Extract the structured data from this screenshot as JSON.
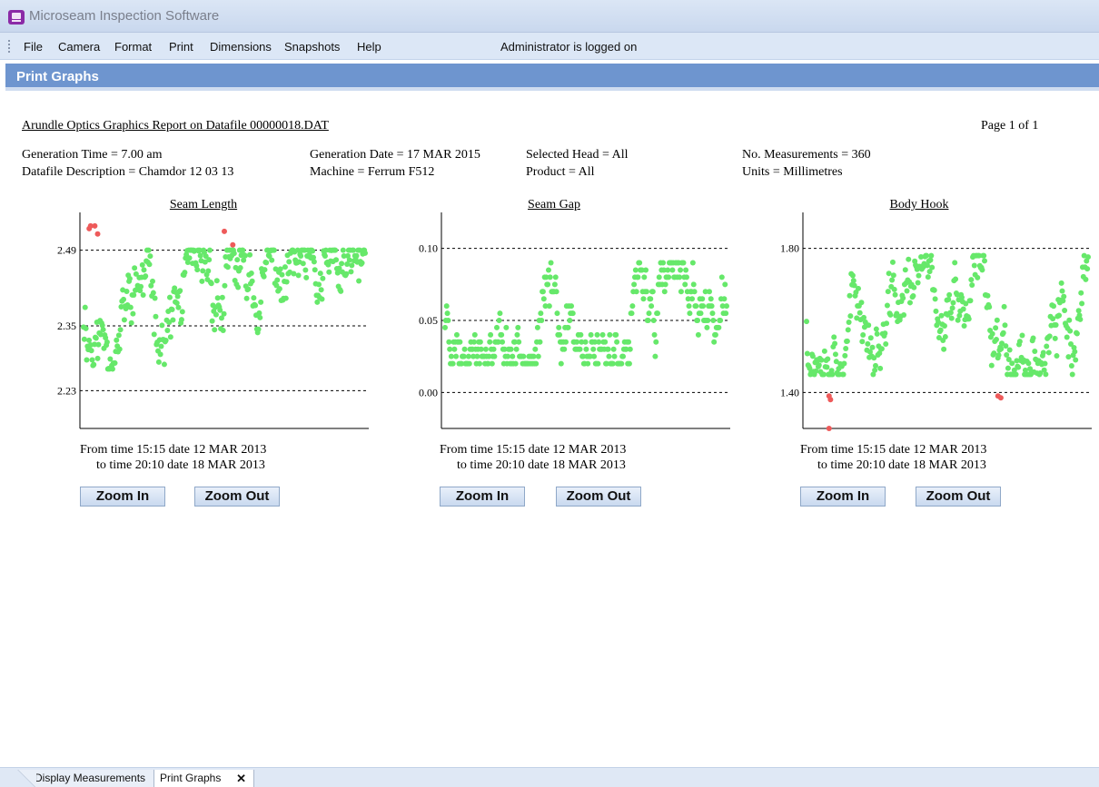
{
  "window": {
    "title": "Microseam Inspection Software"
  },
  "menu": {
    "items": [
      {
        "label": "File"
      },
      {
        "label": "Camera"
      },
      {
        "label": "Format"
      },
      {
        "label": "Print"
      },
      {
        "label": "Dimensions"
      },
      {
        "label": "Snapshots"
      },
      {
        "label": "Help"
      }
    ],
    "status": "Administrator is logged on"
  },
  "header": {
    "title": "Print Graphs"
  },
  "report": {
    "title": "Arundle Optics Graphics Report on Datafile 00000018.DAT",
    "page": "Page 1 of 1",
    "generation_time": "Generation Time = 7.00 am",
    "datafile_description": "Datafile Description = Chamdor 12 03 13",
    "generation_date": "Generation Date = 17 MAR 2015",
    "machine": "Machine = Ferrum F512",
    "selected_head": "Selected Head = All",
    "product": "Product = All",
    "no_measurements": "No. Measurements = 360",
    "units": "Units = Millimetres"
  },
  "buttons": {
    "zoom_in": "Zoom In",
    "zoom_out": "Zoom Out"
  },
  "colors": {
    "in_spec": "#66e86a",
    "out_of_spec": "#ee5a5a",
    "header": "#6e95cf"
  },
  "chart_data": [
    {
      "type": "scatter",
      "title": "Seam Length",
      "ticks": [
        "2.49",
        "2.35",
        "2.23"
      ],
      "limits": [
        2.23,
        2.49
      ],
      "nominal": 2.35,
      "ylim": [
        2.16,
        2.56
      ],
      "points": 360,
      "seed": 11,
      "band": [
        2.27,
        2.49
      ],
      "outliers": [
        [
          0.02,
          2.53
        ],
        [
          0.025,
          2.535
        ],
        [
          0.04,
          2.535
        ],
        [
          0.05,
          2.52
        ],
        [
          0.5,
          2.525
        ],
        [
          0.53,
          2.5
        ]
      ],
      "time_from": "From time 15:15 date 12 MAR 2013",
      "time_to": "to time 20:10 date 18 MAR 2013"
    },
    {
      "type": "scatter",
      "title": "Seam Gap",
      "ticks": [
        "0.10",
        "0.05",
        "0.00"
      ],
      "limits": [
        0.0,
        0.1
      ],
      "nominal": 0.05,
      "ylim": [
        -0.025,
        0.125
      ],
      "points": 360,
      "seed": 23,
      "band": [
        0.02,
        0.09
      ],
      "outliers": [],
      "time_from": "From time 15:15 date 12 MAR 2013",
      "time_to": "to time 20:10 date 18 MAR 2013"
    },
    {
      "type": "scatter",
      "title": "Body Hook",
      "ticks": [
        "1.80",
        "1.40"
      ],
      "limits": [
        1.4,
        1.8
      ],
      "nominal": 1.6,
      "ylim": [
        1.3,
        1.9
      ],
      "points": 360,
      "seed": 37,
      "band": [
        1.45,
        1.78
      ],
      "outliers": [
        [
          0.08,
          1.39
        ],
        [
          0.085,
          1.38
        ],
        [
          0.08,
          1.3
        ],
        [
          0.68,
          1.39
        ],
        [
          0.69,
          1.385
        ]
      ],
      "time_from": "From time 15:15 date 12 MAR 2013",
      "time_to": "to time 20:10 date 18 MAR 2013"
    }
  ],
  "tabs": [
    {
      "label": "Display Measurements"
    },
    {
      "label": "Print Graphs"
    }
  ]
}
